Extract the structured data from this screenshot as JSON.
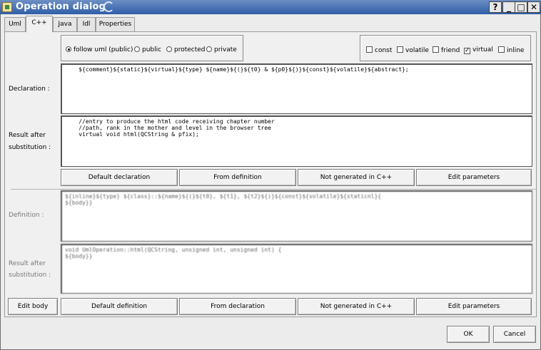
{
  "window": {
    "title": "Operation dialog"
  },
  "titlebar_buttons": [
    "?",
    "_",
    "□",
    "✕"
  ],
  "tabs": [
    {
      "label": "Uml"
    },
    {
      "label": "C++"
    },
    {
      "label": "Java"
    },
    {
      "label": "Idl"
    },
    {
      "label": "Properties"
    }
  ],
  "visibility": {
    "options": [
      "follow uml (public)",
      "public",
      "protected",
      "private"
    ],
    "selected": "follow uml (public)"
  },
  "modifiers": {
    "options": [
      {
        "label": "const",
        "checked": false
      },
      {
        "label": "volatile",
        "checked": false
      },
      {
        "label": "friend",
        "checked": false
      },
      {
        "label": "virtual",
        "checked": true
      },
      {
        "label": "inline",
        "checked": false
      }
    ]
  },
  "declaration": {
    "label": "Declaration :",
    "value": "    ${comment}${static}${virtual}${type} ${name}${(}${t0} & ${p0}${)}${const}${volatile}${abstract};"
  },
  "decl_result": {
    "label_line1": "Result after",
    "label_line2": "substitution :",
    "value": "    //entry to produce the html code receiving chapter number\n    //path, rank in the mother and level in the browser tree\n    virtual void html(QCString & pfix);"
  },
  "decl_buttons": {
    "default_declaration": "Default declaration",
    "from_definition": "From definition",
    "not_generated": "Not generated in C++",
    "edit_parameters": "Edit parameters"
  },
  "definition": {
    "label": "Definition :",
    "value": "${inline}${type} ${class}::${name}${(}${t0}, ${t1}, ${t2}${)}${const}${volatile}${staticnl}{\n${body}}"
  },
  "def_result": {
    "label_line1": "Result after",
    "label_line2": "substitution :",
    "value": "void UmlOperation::html(QCString, unsigned int, unsigned int) {\n${body}}"
  },
  "def_buttons": {
    "edit_body": "Edit body",
    "default_definition": "Default definition",
    "from_declaration": "From declaration",
    "not_generated": "Not generated in C++",
    "edit_parameters": "Edit parameters"
  },
  "footer": {
    "ok": "OK",
    "cancel": "Cancel"
  }
}
